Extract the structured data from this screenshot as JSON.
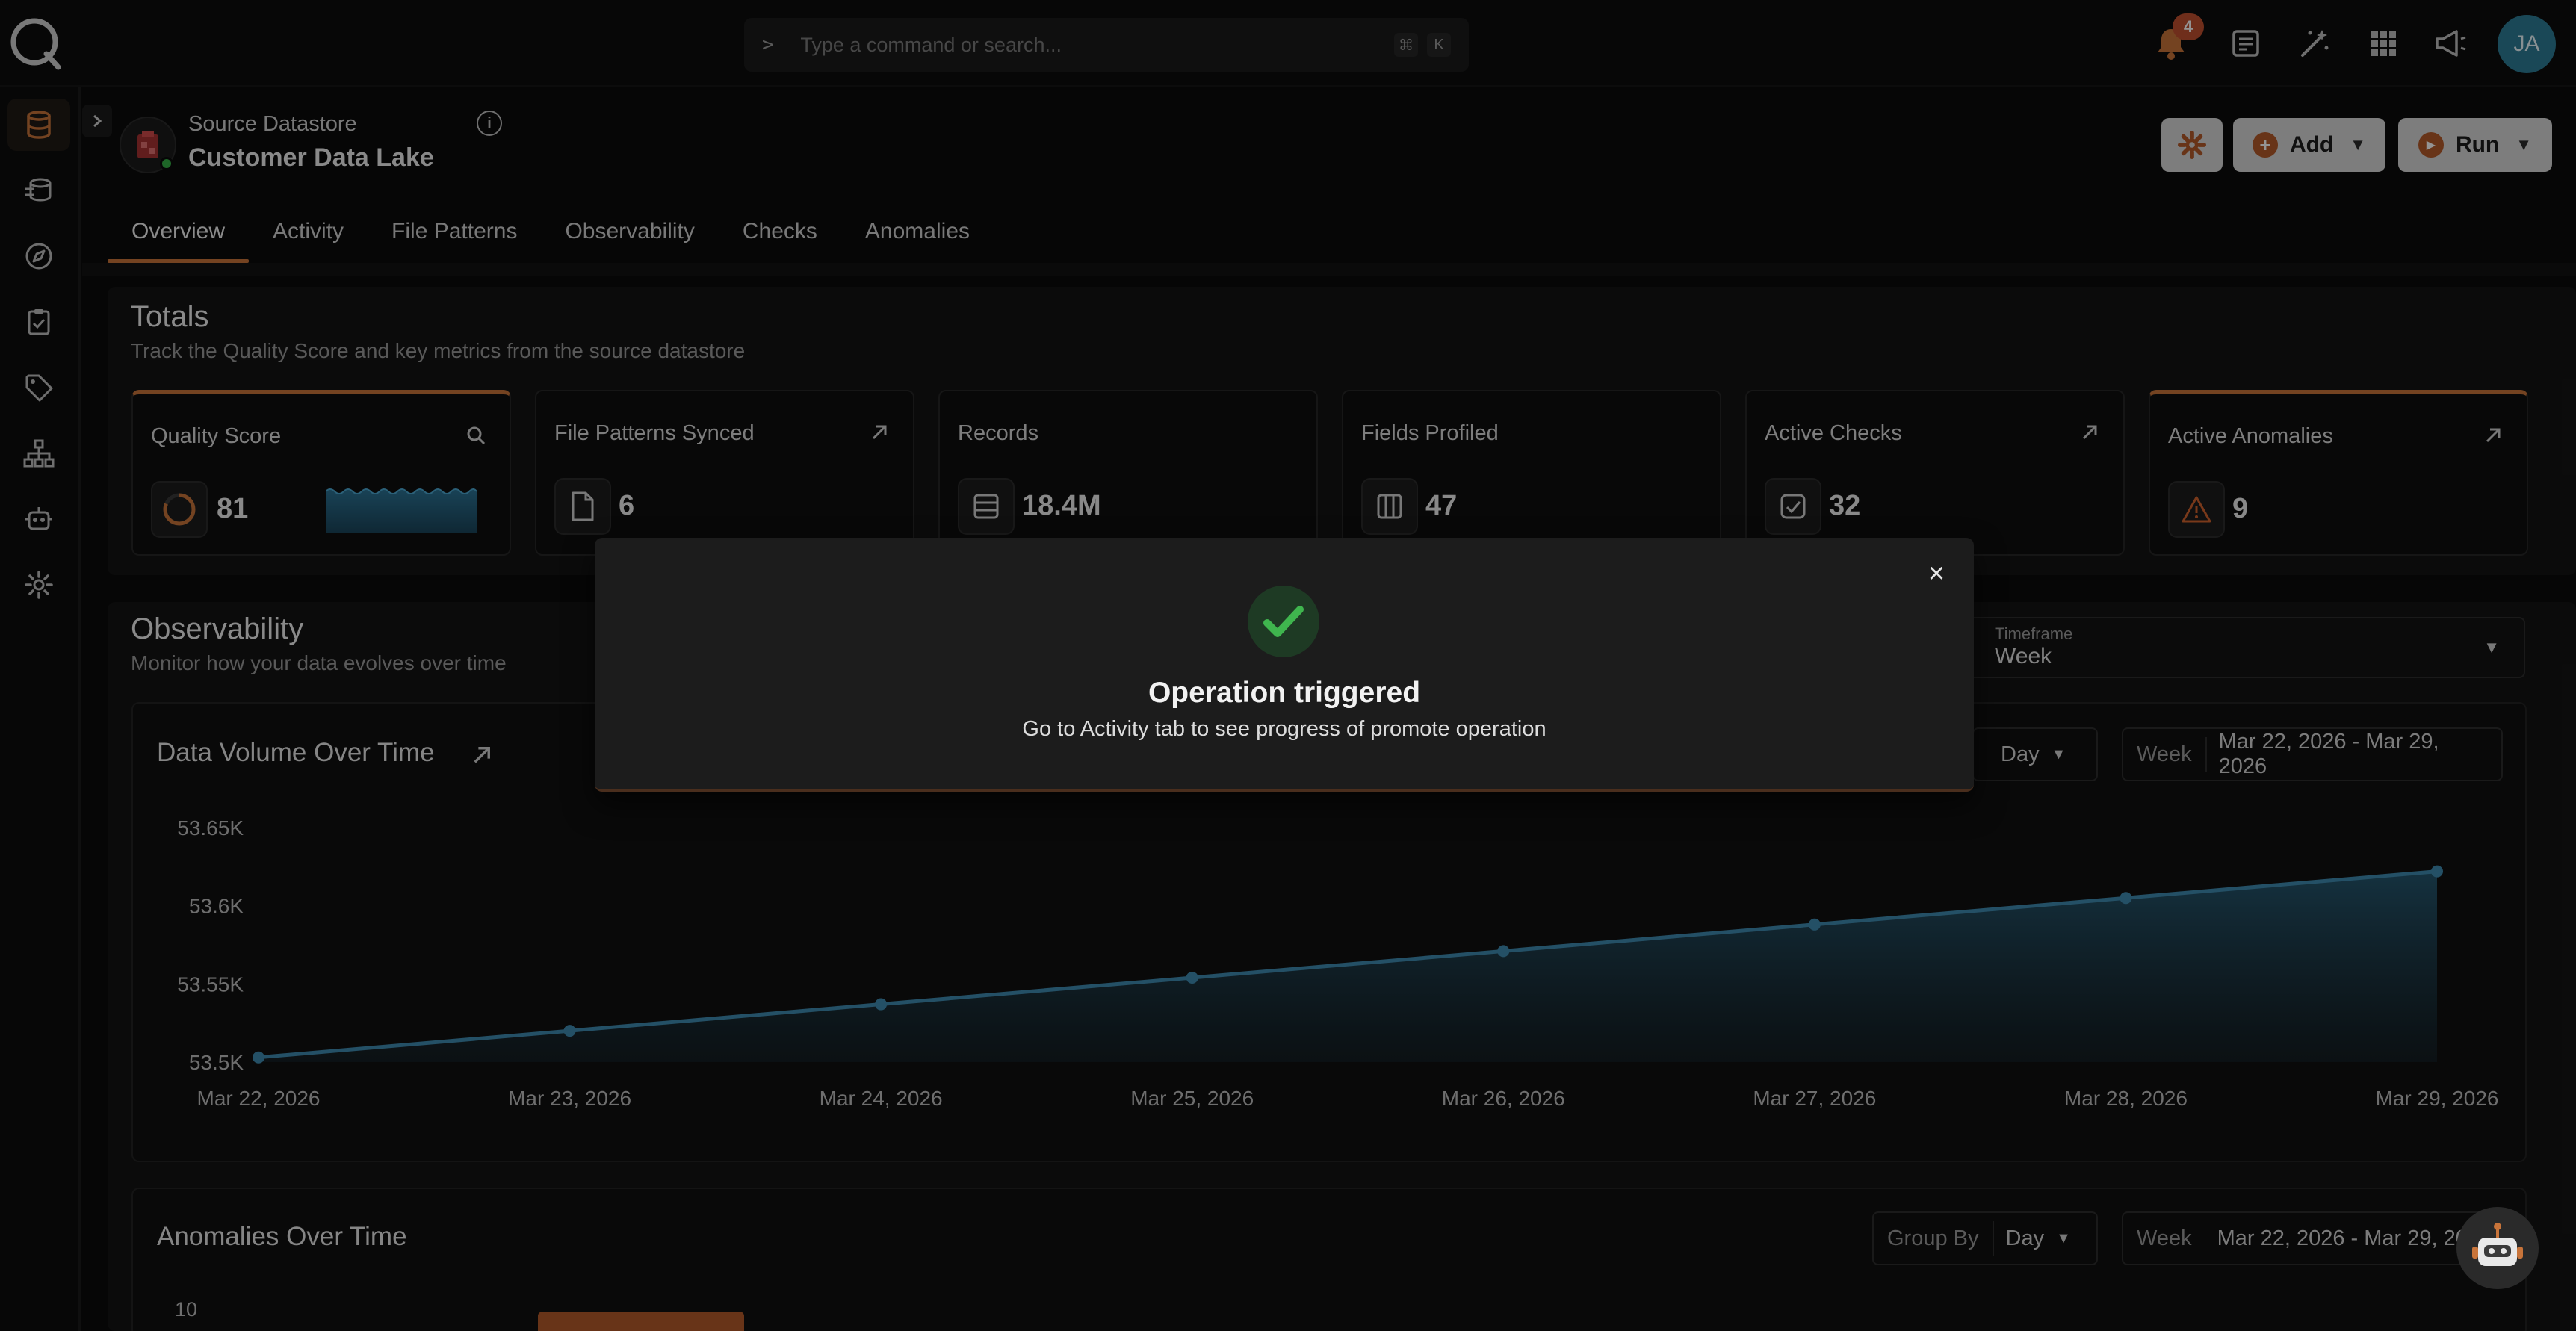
{
  "search": {
    "placeholder": "Type a command or search...",
    "kbd_cmd": "⌘",
    "kbd_key": "K"
  },
  "notifications": {
    "count": "4"
  },
  "user": {
    "initials": "JA"
  },
  "sidebar": {
    "items": [
      {
        "icon": "database-icon",
        "active": true
      },
      {
        "icon": "data-stack-icon"
      },
      {
        "icon": "compass-icon"
      },
      {
        "icon": "clipboard-check-icon"
      },
      {
        "icon": "tag-icon"
      },
      {
        "icon": "hierarchy-icon"
      },
      {
        "icon": "robot-icon"
      },
      {
        "icon": "gear-icon"
      }
    ]
  },
  "datastore": {
    "type": "Source Datastore",
    "name": "Customer Data Lake"
  },
  "header_buttons": {
    "add": "Add",
    "run": "Run"
  },
  "tabs": [
    "Overview",
    "Activity",
    "File Patterns",
    "Observability",
    "Checks",
    "Anomalies"
  ],
  "totals": {
    "title": "Totals",
    "subtitle": "Track the Quality Score and key metrics from the source datastore",
    "cards": [
      {
        "label": "Quality Score",
        "value": "81"
      },
      {
        "label": "File Patterns Synced",
        "value": "6"
      },
      {
        "label": "Records",
        "value": "18.4M"
      },
      {
        "label": "Fields Profiled",
        "value": "47"
      },
      {
        "label": "Active Checks",
        "value": "32"
      },
      {
        "label": "Active Anomalies",
        "value": "9"
      }
    ]
  },
  "observability": {
    "title": "Observability",
    "subtitle": "Monitor how your data evolves over time",
    "timeframe_label": "Timeframe",
    "timeframe_value": "Week"
  },
  "volume_chart_header": {
    "title": "Data Volume Over Time",
    "group_value": "Day",
    "period_label": "Week",
    "range": "Mar 22, 2026 - Mar 29, 2026"
  },
  "chart_data": {
    "type": "area",
    "title": "Data Volume Over Time",
    "x": [
      "Mar 22, 2026",
      "Mar 23, 2026",
      "Mar 24, 2026",
      "Mar 25, 2026",
      "Mar 26, 2026",
      "Mar 27, 2026",
      "Mar 28, 2026",
      "Mar 29, 2026"
    ],
    "values": [
      53503,
      53520,
      53537,
      53554,
      53571,
      53588,
      53605,
      53622
    ],
    "yticks": [
      "53.65K",
      "53.6K",
      "53.55K",
      "53.5K"
    ],
    "ylim": [
      53500,
      53650
    ],
    "color": "#3e8bb0"
  },
  "anomalies_chart": {
    "title": "Anomalies Over Time",
    "group_label": "Group By",
    "group_value": "Day",
    "period_label": "Week",
    "range": "Mar 22, 2026 - Mar 29, 2026",
    "y_top": "10"
  },
  "modal": {
    "title": "Operation triggered",
    "message": "Go to Activity tab to see progress of promote operation",
    "close": "×"
  },
  "colors": {
    "accent": "#c8743a",
    "success": "#3fb54e",
    "chart": "#3e8bb0"
  }
}
